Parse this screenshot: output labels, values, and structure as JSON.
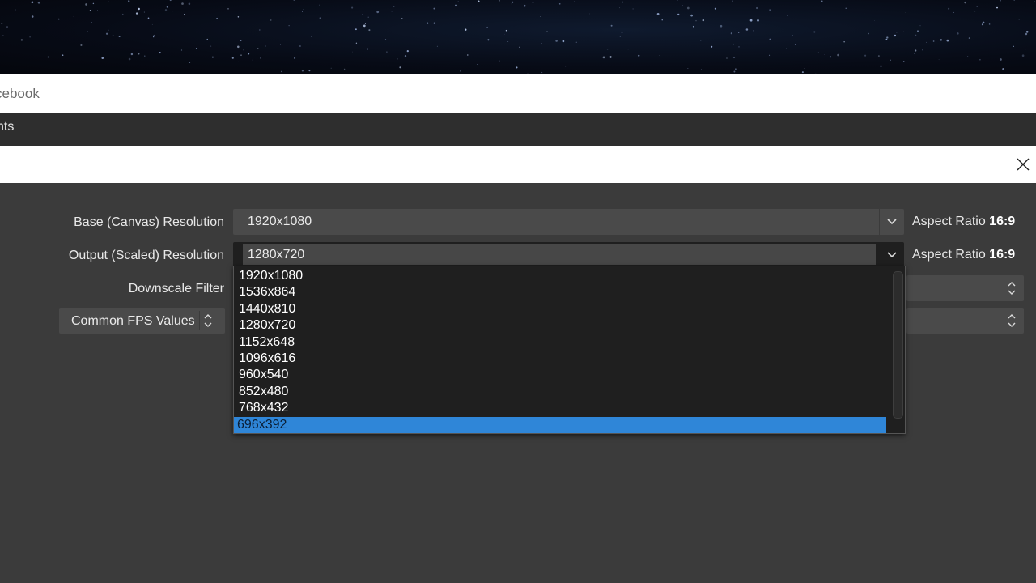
{
  "browser": {
    "address_text": "cebook"
  },
  "menu": {
    "partial_label": "nts"
  },
  "dialog": {
    "close_icon": "close-icon"
  },
  "video": {
    "base_resolution": {
      "label": "Base (Canvas) Resolution",
      "value": "1920x1080",
      "aspect_prefix": "Aspect Ratio",
      "aspect_value": "16:9"
    },
    "output_resolution": {
      "label": "Output (Scaled) Resolution",
      "value": "1280x720",
      "aspect_prefix": "Aspect Ratio",
      "aspect_value": "16:9"
    },
    "downscale_filter": {
      "label": "Downscale Filter"
    },
    "fps": {
      "type_label": "Common FPS Values"
    }
  },
  "dropdown": {
    "options": [
      "1920x1080",
      "1536x864",
      "1440x810",
      "1280x720",
      "1152x648",
      "1096x616",
      "960x540",
      "852x480",
      "768x432",
      "696x392"
    ],
    "highlighted": "696x392"
  },
  "colors": {
    "highlight": "#2f86d8",
    "dialog_bg": "#3b3b3b",
    "popup_bg": "#1f1f1f"
  }
}
